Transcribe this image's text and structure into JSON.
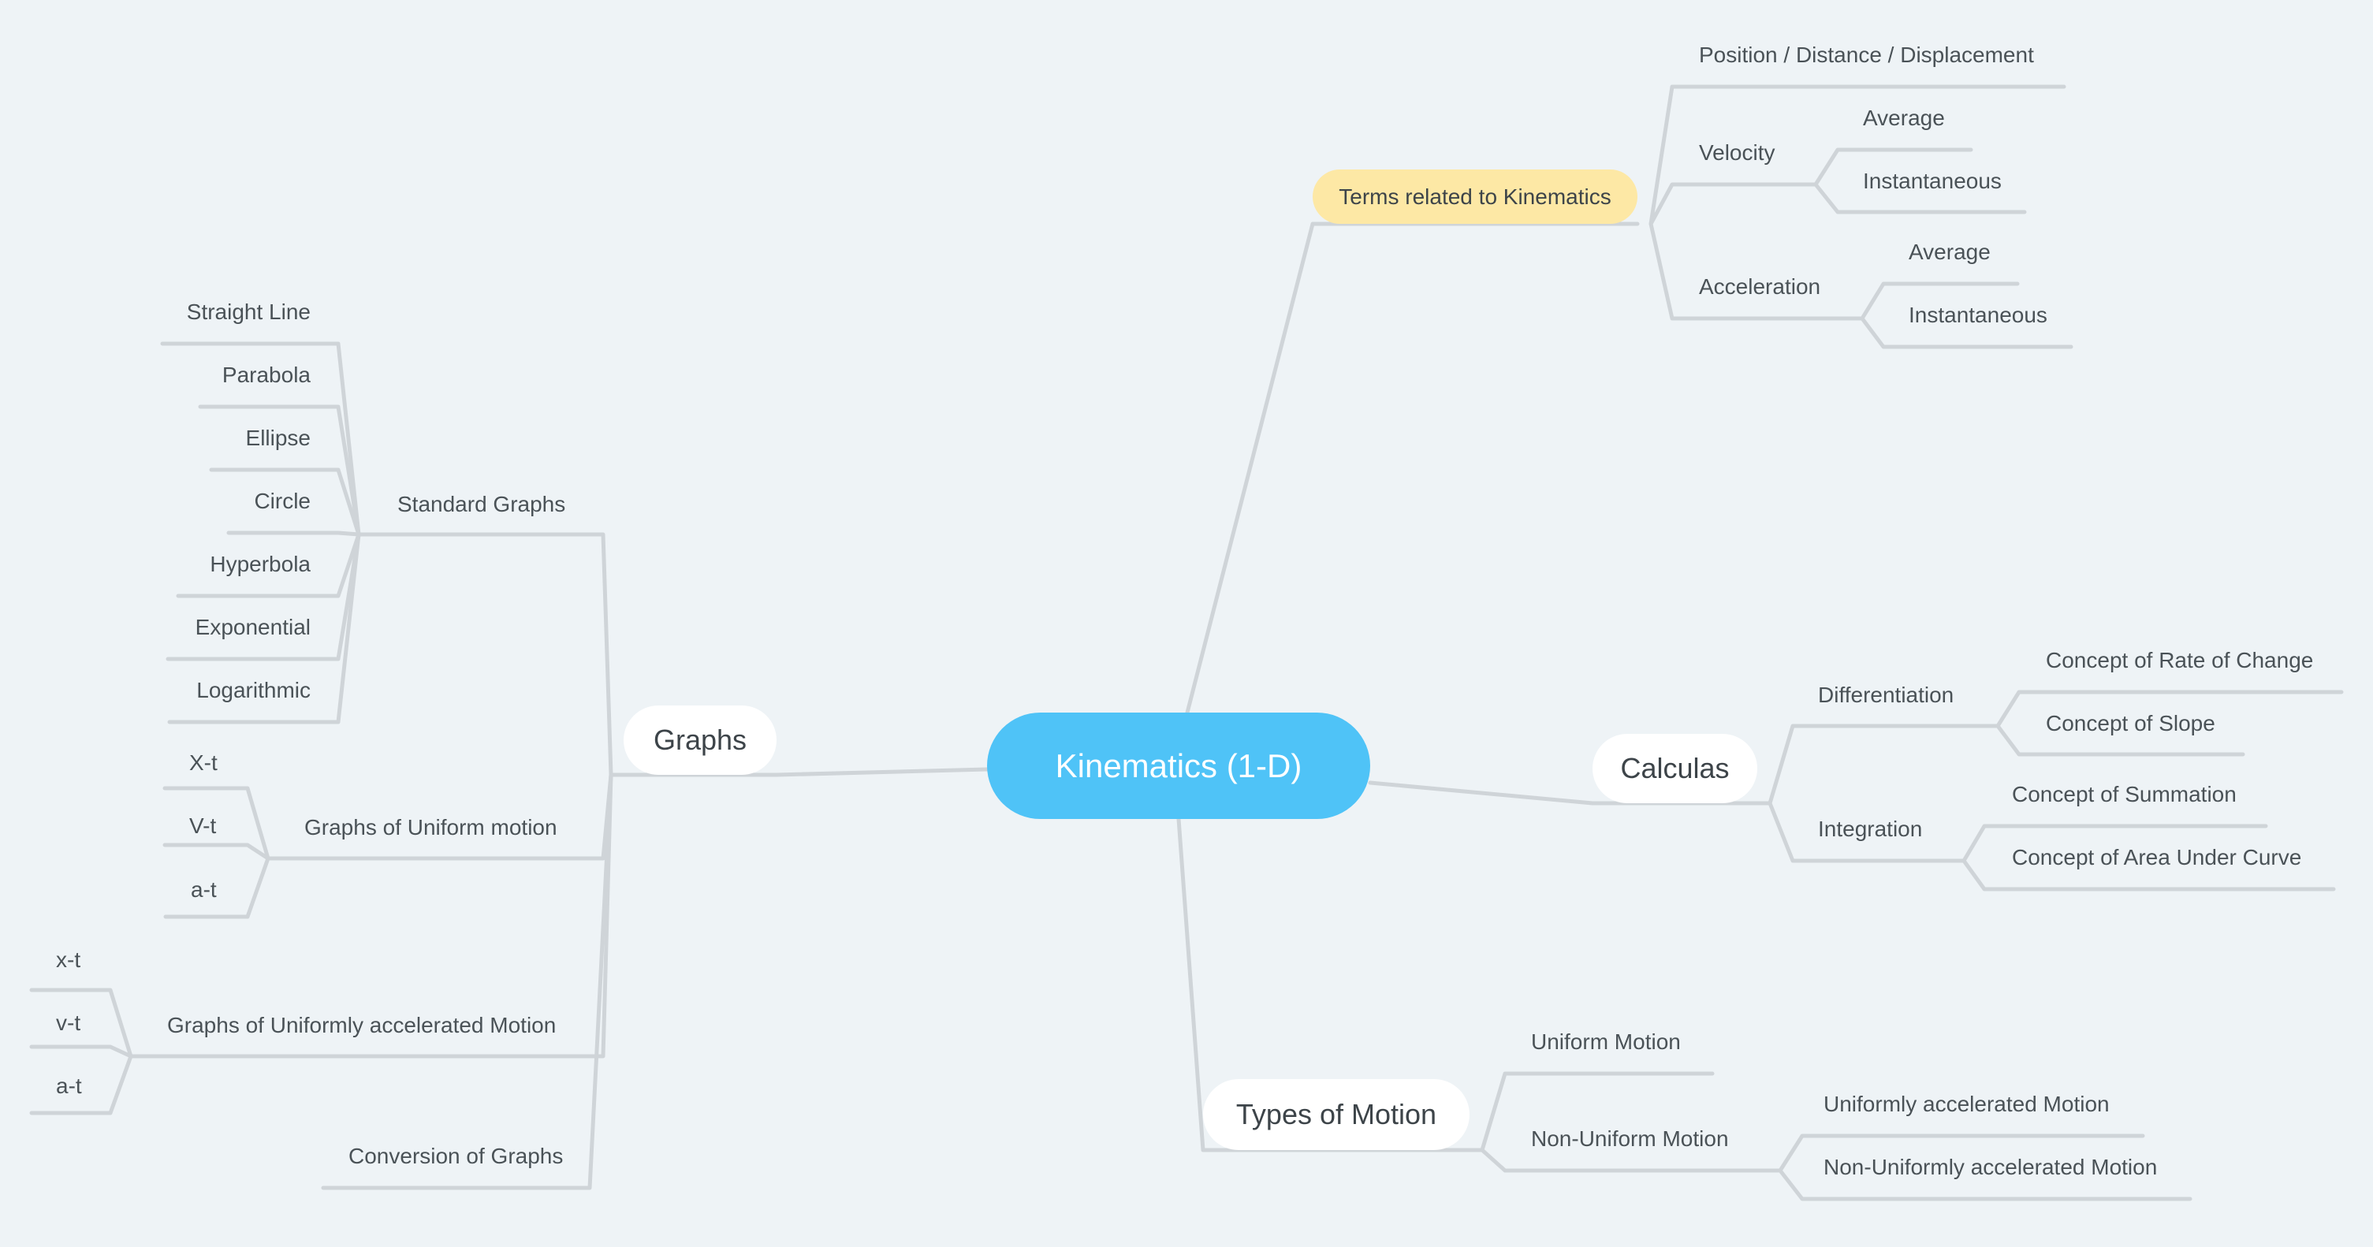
{
  "mindmap": {
    "root": "Kinematics (1-D)",
    "colors": {
      "background": "#eef3f6",
      "root_fill": "#4fc3f7",
      "highlight_fill": "#fde8a5",
      "branch_fill": "#ffffff",
      "line": "#cfd4d8",
      "text": "#3d4449"
    },
    "terms": {
      "label": "Terms related to Kinematics",
      "position": "Position / Distance / Displacement",
      "velocity": {
        "label": "Velocity",
        "children": [
          "Average",
          "Instantaneous"
        ]
      },
      "acceleration": {
        "label": "Acceleration",
        "children": [
          "Average",
          "Instantaneous"
        ]
      }
    },
    "calculas": {
      "label": "Calculas",
      "differentiation": {
        "label": "Differentiation",
        "children": [
          "Concept of Rate of Change",
          "Concept of Slope"
        ]
      },
      "integration": {
        "label": "Integration",
        "children": [
          "Concept of Summation",
          "Concept of Area Under Curve"
        ]
      }
    },
    "types": {
      "label": "Types of Motion",
      "uniform": "Uniform Motion",
      "non_uniform": {
        "label": "Non-Uniform Motion",
        "children": [
          "Uniformly accelerated Motion",
          "Non-Uniformly accelerated Motion"
        ]
      }
    },
    "graphs": {
      "label": "Graphs",
      "standard": {
        "label": "Standard Graphs",
        "children": [
          "Straight Line",
          "Parabola",
          "Ellipse",
          "Circle",
          "Hyperbola",
          "Exponential",
          "Logarithmic"
        ]
      },
      "uniform": {
        "label": "Graphs of Uniform motion",
        "children": [
          "X-t",
          "V-t",
          "a-t"
        ]
      },
      "accelerated": {
        "label": "Graphs of Uniformly accelerated Motion",
        "children": [
          "x-t",
          "v-t",
          "a-t"
        ]
      },
      "conversion": "Conversion of Graphs"
    }
  }
}
